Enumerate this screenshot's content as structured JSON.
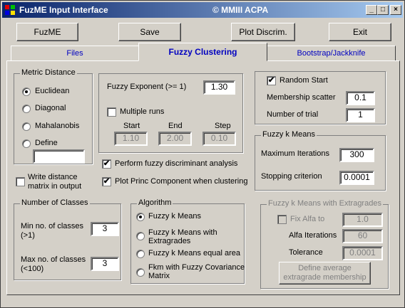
{
  "window": {
    "title": "FuzME  Input Interface",
    "copyright": "© MMIII ACPA",
    "minimize": "_",
    "maximize": "□",
    "close": "×"
  },
  "toolbar": {
    "fuzme_label": "FuzME",
    "save_label": "Save",
    "plot_label": "Plot Discrim.",
    "exit_label": "Exit"
  },
  "tabs": [
    {
      "label": "Files",
      "active": false
    },
    {
      "label": "Fuzzy Clustering",
      "active": true
    },
    {
      "label": "Bootstrap/Jackknife",
      "active": false
    }
  ],
  "metric": {
    "legend": "Metric Distance",
    "options": [
      "Euclidean",
      "Diagonal",
      "Mahalanobis",
      "Define"
    ],
    "selected": "Euclidean",
    "define_value": ""
  },
  "write_distance": {
    "label_line1": "Write distance",
    "label_line2": "matrix in output",
    "checked": false
  },
  "fuzzy_exponent": {
    "label": "Fuzzy Exponent (>= 1)",
    "value": "1.30",
    "multiple_runs_label": "Multiple runs",
    "multiple_runs_checked": false,
    "start_label": "Start",
    "end_label": "End",
    "step_label": "Step",
    "start_value": "1.10",
    "end_value": "2.00",
    "step_value": "0.10"
  },
  "discriminant": {
    "label": "Perform fuzzy discriminant analysis",
    "checked": true
  },
  "princ_component": {
    "label": "Plot Princ Component when clustering",
    "checked": true
  },
  "random": {
    "label": "Random Start",
    "checked": true,
    "scatter_label": "Membership scatter",
    "scatter_value": "0.1",
    "trial_label": "Number of trial",
    "trial_value": "1"
  },
  "fkm": {
    "legend": "Fuzzy k Means",
    "max_iter_label": "Maximum Iterations",
    "max_iter_value": "300",
    "stop_label": "Stopping criterion",
    "stop_value": "0.0001"
  },
  "classes": {
    "legend": "Number of Classes",
    "min_label_line1": "Min no. of classes",
    "min_label_line2": "(>1)",
    "min_value": "3",
    "max_label_line1": "Max no. of classes",
    "max_label_line2": "(<100)",
    "max_value": "3"
  },
  "algorithm": {
    "legend": "Algorithm",
    "options": [
      {
        "line1": "Fuzzy k Means",
        "line2": ""
      },
      {
        "line1": "Fuzzy k Means with",
        "line2": "Extragrades"
      },
      {
        "line1": "Fuzzy k Means equal area",
        "line2": ""
      },
      {
        "line1": "Fkm with Fuzzy Covariance",
        "line2": "Matrix"
      }
    ],
    "selected_index": 0
  },
  "extragrades": {
    "legend": "Fuzzy k Means with Extragrades",
    "fix_alfa_label": "Fix Alfa to",
    "fix_alfa_value": "1.0",
    "alfa_iter_label": "Alfa Iterations",
    "alfa_iter_value": "60",
    "tolerance_label": "Tolerance",
    "tolerance_value": "0.0001",
    "define_button_line1": "Define average",
    "define_button_line2": "extragrade membership"
  }
}
